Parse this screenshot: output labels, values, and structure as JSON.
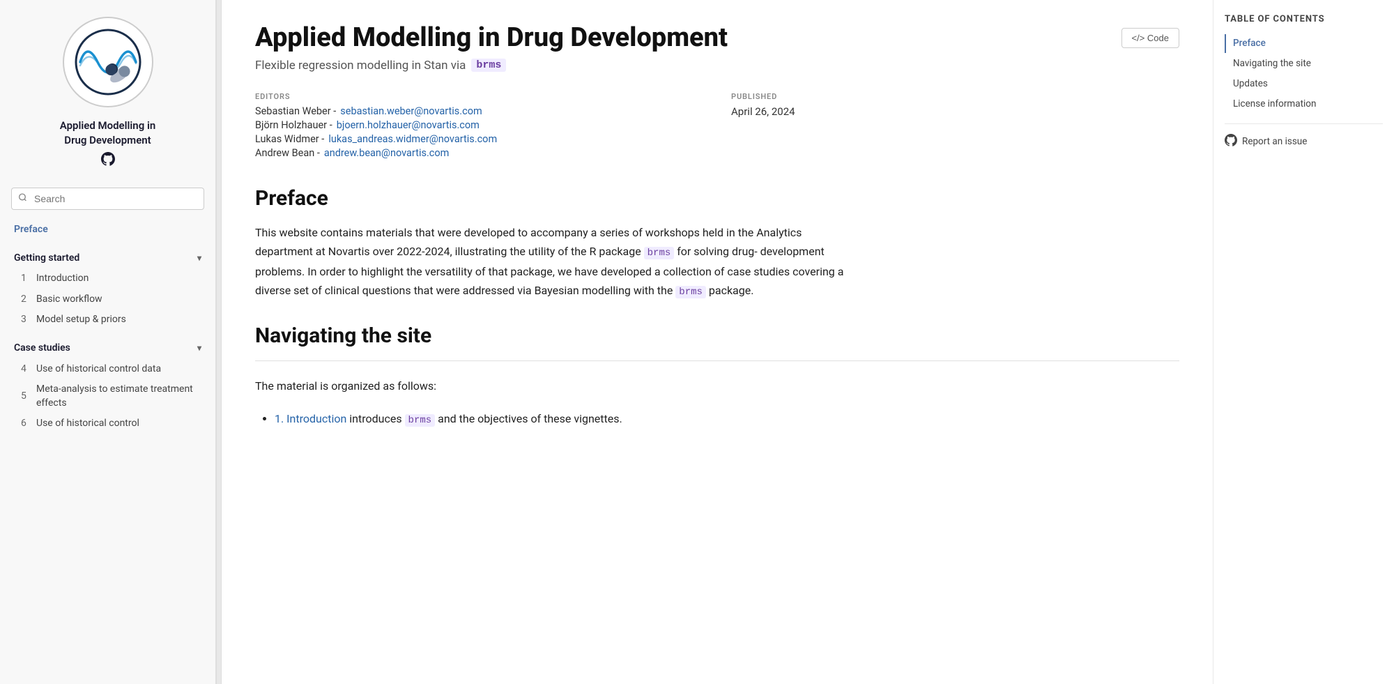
{
  "sidebar": {
    "book_title": "Applied Modelling in\nDrug Development",
    "github_label": "GitHub",
    "search_placeholder": "Search",
    "nav": {
      "preface_label": "Preface",
      "getting_started_label": "Getting started",
      "items_started": [
        {
          "num": "1",
          "label": "Introduction"
        },
        {
          "num": "2",
          "label": "Basic workflow"
        },
        {
          "num": "3",
          "label": "Model setup & priors"
        }
      ],
      "case_studies_label": "Case studies",
      "items_cases": [
        {
          "num": "4",
          "label": "Use of historical control data"
        },
        {
          "num": "5",
          "label": "Meta-analysis to estimate treatment effects"
        },
        {
          "num": "6",
          "label": "Use of historical control"
        }
      ]
    }
  },
  "main": {
    "book_title": "Applied Modelling in Drug Development",
    "subtitle_text": "Flexible regression modelling in Stan via",
    "brms_badge": "brms",
    "code_button_label": "</> Code",
    "metadata": {
      "editors_label": "EDITORS",
      "published_label": "PUBLISHED",
      "published_date": "April 26, 2024",
      "editors": [
        {
          "name": "Sebastian Weber",
          "email": "sebastian.weber@novartis.com"
        },
        {
          "name": "Björn Holzhauer",
          "email": "bjoern.holzhauer@novartis.com"
        },
        {
          "name": "Lukas Widmer",
          "email": "lukas_andreas.widmer@novartis.com"
        },
        {
          "name": "Andrew Bean",
          "email": "andrew.bean@novartis.com"
        }
      ]
    },
    "preface_title": "Preface",
    "preface_text": "This website contains materials that were developed to accompany a series of workshops held in the Analytics department at Novartis over 2022-2024, illustrating the utility of the R package",
    "brms_inline": "brms",
    "preface_text2": "for solving drug- development problems. In order to highlight the versatility of that package, we have developed a collection of case studies covering a diverse set of clinical questions that were addressed via Bayesian modelling with the",
    "brms_inline2": "brms",
    "preface_text3": "package.",
    "navigating_title": "Navigating the site",
    "navigating_intro": "The material is organized as follows:",
    "nav_bullets": [
      {
        "text": "1. Introduction introduces",
        "brms": "brms",
        "rest": "and the objectives of these vignettes."
      }
    ]
  },
  "toc": {
    "heading": "Table of contents",
    "items": [
      {
        "label": "Preface",
        "active": true
      },
      {
        "label": "Navigating the site",
        "active": false
      },
      {
        "label": "Updates",
        "active": false
      },
      {
        "label": "License information",
        "active": false
      }
    ],
    "report_issue_label": "Report an issue"
  }
}
